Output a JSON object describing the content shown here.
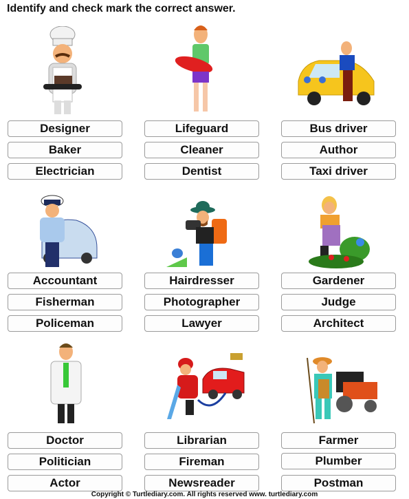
{
  "title": "Identify and check mark the correct answer.",
  "questions": [
    {
      "picture": "baker-illustration",
      "options": [
        "Designer",
        "Baker",
        "Electrician"
      ]
    },
    {
      "picture": "lifeguard-illustration",
      "options": [
        "Lifeguard",
        "Cleaner",
        "Dentist"
      ]
    },
    {
      "picture": "taxi-driver-illustration",
      "options": [
        "Bus driver",
        "Author",
        "Taxi driver"
      ]
    },
    {
      "picture": "policeman-illustration",
      "options": [
        "Accountant",
        "Fisherman",
        "Policeman"
      ]
    },
    {
      "picture": "photographer-illustration",
      "options": [
        "Hairdresser",
        "Photographer",
        "Lawyer"
      ]
    },
    {
      "picture": "gardener-illustration",
      "options": [
        "Gardener",
        "Judge",
        "Architect"
      ]
    },
    {
      "picture": "doctor-illustration",
      "options": [
        "Doctor",
        "Politician",
        "Actor"
      ]
    },
    {
      "picture": "fireman-illustration",
      "options": [
        "Librarian",
        "Fireman",
        "Newsreader"
      ]
    },
    {
      "picture": "farmer-illustration",
      "options": [
        "Farmer",
        "Plumber",
        "Postman"
      ]
    }
  ],
  "footer": "Copyright © Turtlediary.com. All rights reserved   www. turtlediary.com"
}
